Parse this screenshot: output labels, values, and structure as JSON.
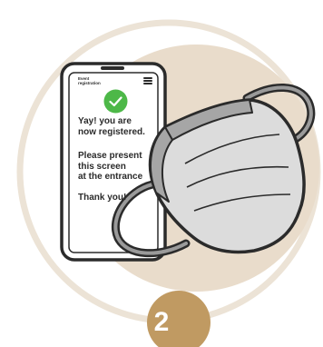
{
  "colors": {
    "outer_ring": "#ece3d6",
    "inner_disc": "#e9dccb",
    "badge": "#c09a62",
    "check": "#4db848",
    "outline": "#2b2b2b",
    "mask_fill": "#dcdcdc",
    "mask_band": "#a6a6a6"
  },
  "screen": {
    "header": "Event\nregistration",
    "icons": {
      "menu": "hamburger-menu-icon",
      "check": "check-circle-icon"
    },
    "message_registered": "Yay! you are\nnow registered.",
    "message_present": "Please present\nthis screen\nat the entrance",
    "message_thanks": "Thank you!"
  },
  "badge": {
    "step": "2"
  }
}
